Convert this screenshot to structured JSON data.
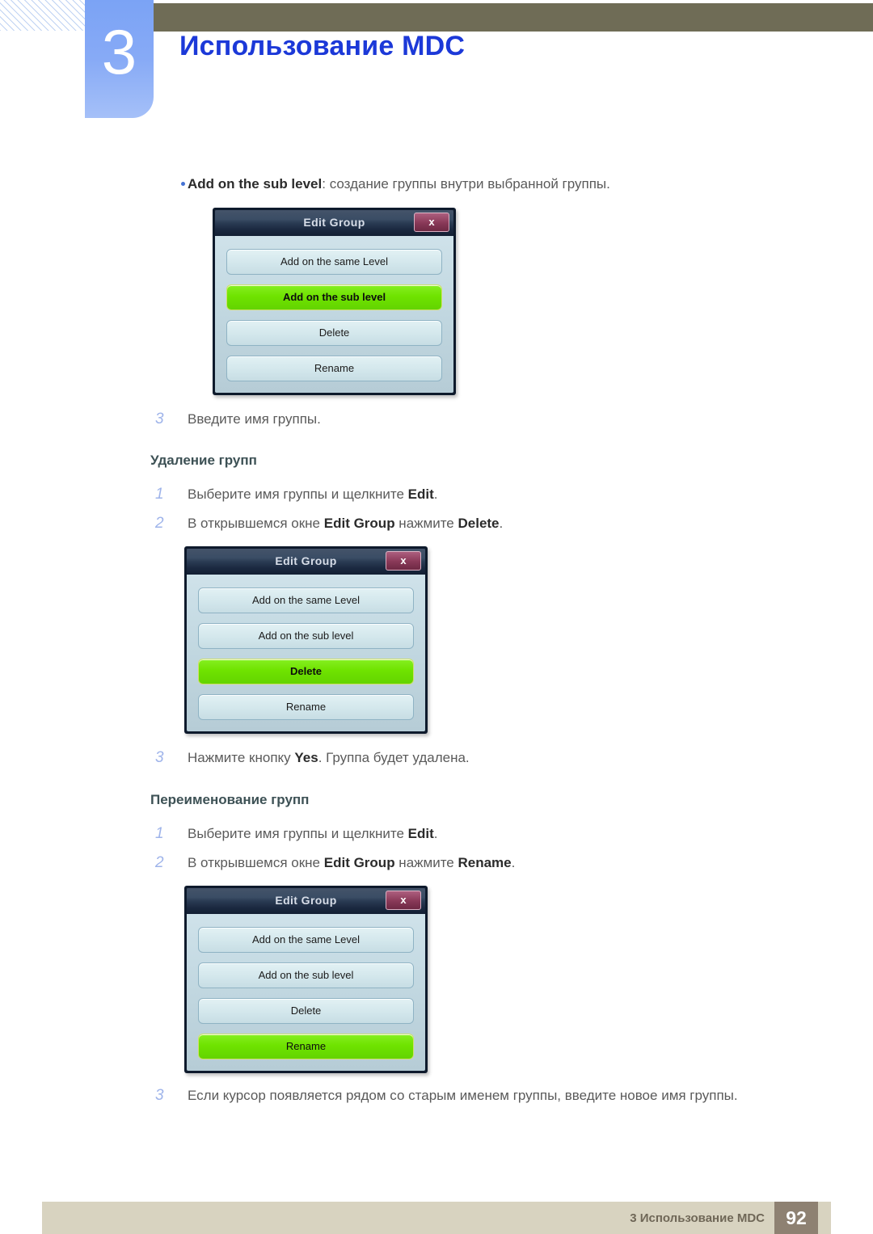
{
  "header": {
    "chapter_number": "3",
    "chapter_title": "Использование MDC",
    "accent_blue": "#1c39d8",
    "badge_blue": "#87aaf6",
    "olive": "#6f6c56"
  },
  "footer": {
    "text": "3 Использование MDC",
    "page_number": "92",
    "bar_color": "#d8d3c0",
    "page_box_color": "#8e8172"
  },
  "content": {
    "bullet": {
      "term": "Add on the sub level",
      "separator": ": ",
      "description": "создание группы внутри выбранной группы."
    },
    "step_enter_name": {
      "num": "3",
      "text": "Введите имя группы."
    },
    "delete_section": {
      "heading": "Удаление групп",
      "steps": [
        {
          "num": "1",
          "pre": "Выберите имя группы и щелкните ",
          "bold": "Edit",
          "post": "."
        },
        {
          "num": "2",
          "pre": "В открывшемся окне ",
          "bold": "Edit Group",
          "mid": " нажмите ",
          "bold2": "Delete",
          "post": "."
        },
        {
          "num": "3",
          "pre": "Нажмите кнопку ",
          "bold": "Yes",
          "post": ". Группа будет удалена."
        }
      ]
    },
    "rename_section": {
      "heading": "Переименование групп",
      "steps": [
        {
          "num": "1",
          "pre": "Выберите имя группы и щелкните ",
          "bold": "Edit",
          "post": "."
        },
        {
          "num": "2",
          "pre": "В открывшемся окне ",
          "bold": "Edit Group",
          "mid": " нажмите ",
          "bold2": "Rename",
          "post": "."
        },
        {
          "num": "3",
          "pre": "Если курсор появляется рядом со старым именем группы, введите новое имя группы.",
          "bold": "",
          "post": ""
        }
      ]
    }
  },
  "dialogs": [
    {
      "title": "Edit Group",
      "close_label": "x",
      "buttons": [
        {
          "label": "Add on the same Level",
          "highlighted": false,
          "bold": false
        },
        {
          "label": "Add on the sub level",
          "highlighted": true,
          "bold": true
        },
        {
          "label": "Delete",
          "highlighted": false,
          "bold": false
        },
        {
          "label": "Rename",
          "highlighted": false,
          "bold": false
        }
      ]
    },
    {
      "title": "Edit Group",
      "close_label": "x",
      "buttons": [
        {
          "label": "Add on the same Level",
          "highlighted": false,
          "bold": false
        },
        {
          "label": "Add on the sub level",
          "highlighted": false,
          "bold": false
        },
        {
          "label": "Delete",
          "highlighted": true,
          "bold": true
        },
        {
          "label": "Rename",
          "highlighted": false,
          "bold": false
        }
      ]
    },
    {
      "title": "Edit Group",
      "close_label": "x",
      "buttons": [
        {
          "label": "Add on the same Level",
          "highlighted": false,
          "bold": false
        },
        {
          "label": "Add on the sub level",
          "highlighted": false,
          "bold": false
        },
        {
          "label": "Delete",
          "highlighted": false,
          "bold": false
        },
        {
          "label": "Rename",
          "highlighted": true,
          "bold": false
        }
      ]
    }
  ]
}
